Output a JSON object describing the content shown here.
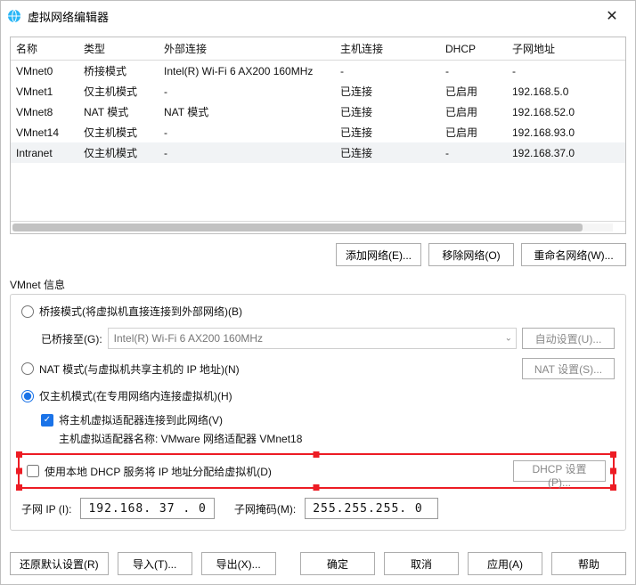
{
  "title": "虚拟网络编辑器",
  "table": {
    "headers": {
      "name": "名称",
      "type": "类型",
      "ext": "外部连接",
      "host": "主机连接",
      "dhcp": "DHCP",
      "subnet": "子网地址"
    },
    "rows": [
      {
        "name": "VMnet0",
        "type": "桥接模式",
        "ext": "Intel(R) Wi-Fi 6 AX200 160MHz",
        "host": "-",
        "dhcp": "-",
        "subnet": "-"
      },
      {
        "name": "VMnet1",
        "type": "仅主机模式",
        "ext": "-",
        "host": "已连接",
        "dhcp": "已启用",
        "subnet": "192.168.5.0"
      },
      {
        "name": "VMnet8",
        "type": "NAT 模式",
        "ext": "NAT 模式",
        "host": "已连接",
        "dhcp": "已启用",
        "subnet": "192.168.52.0"
      },
      {
        "name": "VMnet14",
        "type": "仅主机模式",
        "ext": "-",
        "host": "已连接",
        "dhcp": "已启用",
        "subnet": "192.168.93.0"
      },
      {
        "name": "Intranet",
        "type": "仅主机模式",
        "ext": "-",
        "host": "已连接",
        "dhcp": "-",
        "subnet": "192.168.37.0",
        "selected": true
      }
    ]
  },
  "buttons": {
    "add": "添加网络(E)...",
    "remove": "移除网络(O)",
    "rename": "重命名网络(W)..."
  },
  "info_title": "VMnet 信息",
  "bridge": {
    "label": "桥接模式(将虚拟机直接连接到外部网络)(B)",
    "bridged_to": "已桥接至(G):",
    "combo": "Intel(R) Wi-Fi 6 AX200 160MHz",
    "auto": "自动设置(U)..."
  },
  "nat": {
    "label": "NAT 模式(与虚拟机共享主机的 IP 地址)(N)",
    "settings": "NAT 设置(S)..."
  },
  "hostonly": {
    "label": "仅主机模式(在专用网络内连接虚拟机)(H)",
    "connect": "将主机虚拟适配器连接到此网络(V)",
    "adapter_line": "主机虚拟适配器名称: VMware 网络适配器 VMnet18"
  },
  "dhcp": {
    "label": "使用本地 DHCP 服务将 IP 地址分配给虚拟机(D)",
    "settings": "DHCP 设置(P)..."
  },
  "subnet": {
    "ip_label": "子网 IP (I):",
    "ip": "192.168. 37 . 0",
    "mask_label": "子网掩码(M):",
    "mask": "255.255.255. 0"
  },
  "bottom": {
    "restore": "还原默认设置(R)",
    "import": "导入(T)...",
    "export": "导出(X)...",
    "ok": "确定",
    "cancel": "取消",
    "apply": "应用(A)",
    "help": "帮助"
  }
}
